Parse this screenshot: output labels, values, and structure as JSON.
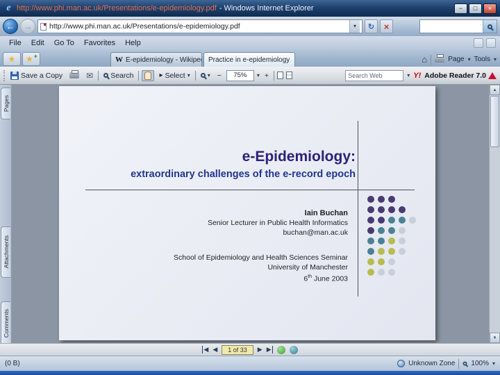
{
  "titlebar": {
    "url": "http://www.phi.man.ac.uk/Presentations/e-epidemiology.pdf",
    "app": "- Windows Internet Explorer"
  },
  "navbar": {
    "url": "http://www.phi.man.ac.uk/Presentations/e-epidemiology.pdf"
  },
  "menubar": {
    "items": [
      "File",
      "Edit",
      "Go To",
      "Favorites",
      "Help"
    ]
  },
  "tabbar": {
    "tab1_badge": "W",
    "tab1": "E-epidemiology - Wikiped...",
    "tab2": "Practice in e-epidemiology",
    "page": "Page",
    "tools": "Tools"
  },
  "reader_toolbar": {
    "save": "Save a Copy",
    "search": "Search",
    "select": "Select",
    "zoom": "75%",
    "search_web": "Search Web",
    "yahoo": "Y!",
    "brand": "Adobe Reader 7.0"
  },
  "nav_pane": {
    "pages": "Pages",
    "attachments": "Attachments",
    "comments": "Comments"
  },
  "slide": {
    "title": "e-Epidemiology:",
    "subtitle": "extraordinary challenges of the e-record epoch",
    "author_name": "Iain Buchan",
    "author_role": "Senior Lecturer in Public Health Informatics",
    "author_email": "buchan@man.ac.uk",
    "event_line1": "School of Epidemiology and Health Sciences Seminar",
    "event_line2": "University of Manchester",
    "date_day": "6",
    "date_ordinal": "th",
    "date_rest": " June 2003",
    "dot_grid": {
      "colors": {
        "purple": "#493a72",
        "teal": "#4b8195",
        "olive": "#b8bc4b",
        "gray": "#c9cedb"
      },
      "rows": [
        [
          "purple",
          "purple",
          "purple",
          "",
          ""
        ],
        [
          "purple",
          "purple",
          "purple",
          "purple",
          ""
        ],
        [
          "purple",
          "purple",
          "teal",
          "teal",
          "gray"
        ],
        [
          "purple",
          "teal",
          "teal",
          "gray",
          ""
        ],
        [
          "teal",
          "teal",
          "olive",
          "gray",
          ""
        ],
        [
          "teal",
          "olive",
          "olive",
          "gray",
          ""
        ],
        [
          "olive",
          "olive",
          "gray",
          "",
          ""
        ],
        [
          "olive",
          "gray",
          "gray",
          "",
          ""
        ]
      ]
    }
  },
  "footer": {
    "pager": "1 of 33"
  },
  "statusbar": {
    "left": "(0 B)",
    "zone": "Unknown Zone",
    "zoom": "100%"
  },
  "icons": {
    "back": "←",
    "forward": "→",
    "refresh": "↻",
    "stop": "×",
    "minimize": "−",
    "maximize": "□",
    "close": "×",
    "star": "★",
    "plus": "+",
    "home": "⌂",
    "mail": "✉",
    "select_arrow": "▸",
    "dropdown": "▾",
    "first": "◀",
    "prev": "◀",
    "next": "▶",
    "last": "▶",
    "scroll_up": "▲",
    "scroll_down": "▼",
    "ie": "e",
    "minus": "−",
    "plus_zoom": "+"
  }
}
